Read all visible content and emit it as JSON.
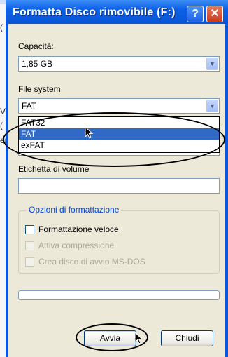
{
  "dialog": {
    "title": "Formatta Disco rimovibile (F:)",
    "help_label": "?",
    "close_label": "✕"
  },
  "background": {
    "fragments": [
      "(",
      "V",
      "(",
      "er"
    ]
  },
  "capacity": {
    "label": "Capacità:",
    "value": "1,85 GB"
  },
  "file_system": {
    "label": "File system",
    "value": "FAT",
    "options": [
      "FAT32",
      "FAT",
      "exFAT"
    ]
  },
  "volume_label": {
    "label": "Etichetta di volume",
    "value": ""
  },
  "format_options": {
    "title": "Opzioni di formattazione",
    "quick_format": "Formattazione veloce",
    "compression": "Attiva compressione",
    "boot_disk": "Crea disco di avvio MS-DOS"
  },
  "buttons": {
    "start": "Avvia",
    "close": "Chiudi"
  },
  "colors": {
    "title_bar": "#0a58da",
    "selection": "#316ac5",
    "group_title": "#0046d5"
  }
}
